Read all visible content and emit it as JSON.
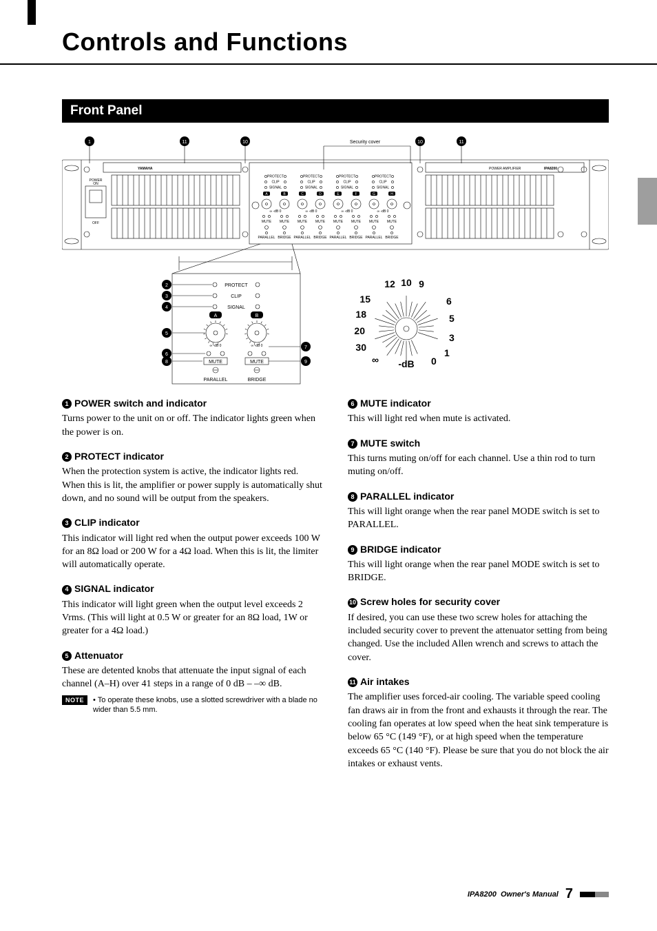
{
  "chapter_title": "Controls and Functions",
  "section_title": "Front Panel",
  "diagram": {
    "security_cover_label": "Security cover",
    "brand": "YAMAHA",
    "model_label": "POWER AMPLIFIER",
    "model_number": "IPA8200",
    "power_on": "POWER\nON",
    "off": "OFF",
    "led_rows": [
      "PROTECT",
      "CLIP",
      "SIGNAL"
    ],
    "channel_letters": [
      "A",
      "B",
      "C",
      "D",
      "E",
      "F",
      "G",
      "H"
    ],
    "db_small": "∞ -dB 0",
    "mute_row": "MUTE",
    "bottom_row_left": "PARALLEL",
    "bottom_row_right": "BRIDGE",
    "callouts_top": [
      "1",
      "11",
      "10",
      "10",
      "11"
    ],
    "detail_callouts": [
      "2",
      "3",
      "4",
      "5",
      "6",
      "8",
      "7",
      "9"
    ],
    "detail_labels": {
      "protect": "PROTECT",
      "clip": "CLIP",
      "signal": "SIGNAL",
      "a": "A",
      "b": "B",
      "mute": "MUTE",
      "parallel": "PARALLEL",
      "bridge": "BRIDGE",
      "db": "∞  -dB  0"
    },
    "dial_ticks": [
      "12",
      "10",
      "9",
      "15",
      "6",
      "18",
      "5",
      "20",
      "3",
      "30",
      "∞",
      "-dB",
      "0",
      "1"
    ]
  },
  "items_left": [
    {
      "num": "1",
      "title": "POWER switch and indicator",
      "body": "Turns power to the unit on or off. The indicator lights green when the power is on."
    },
    {
      "num": "2",
      "title": "PROTECT indicator",
      "body": "When the protection system is active, the indicator lights red. When this is lit, the amplifier or power supply is automatically shut down, and no sound will be output from the speakers."
    },
    {
      "num": "3",
      "title": "CLIP indicator",
      "body": "This indicator will light red when the output power exceeds 100 W for an 8Ω load or 200 W for a 4Ω load. When this is lit, the limiter will automatically operate."
    },
    {
      "num": "4",
      "title": "SIGNAL indicator",
      "body": "This indicator will light green when the output level exceeds 2 Vrms. (This will light at 0.5 W or greater for an 8Ω load, 1W or greater for a 4Ω load.)"
    },
    {
      "num": "5",
      "title": "Attenuator",
      "body": "These are detented knobs that attenuate the input signal of each channel (A–H) over 41 steps in a range of 0 dB – –∞ dB."
    }
  ],
  "note": {
    "badge": "NOTE",
    "bullet": "•",
    "text": "To operate these knobs, use a slotted screwdriver with a blade no wider than 5.5 mm."
  },
  "items_right": [
    {
      "num": "6",
      "title": "MUTE indicator",
      "body": "This will light red when mute is activated."
    },
    {
      "num": "7",
      "title": "MUTE switch",
      "body": "This turns muting on/off for each channel. Use a thin rod to turn muting on/off."
    },
    {
      "num": "8",
      "title": "PARALLEL indicator",
      "body": "This will light orange when the rear panel MODE switch is set to PARALLEL."
    },
    {
      "num": "9",
      "title": "BRIDGE indicator",
      "body": "This will light orange when the rear panel MODE switch is set to BRIDGE."
    },
    {
      "num": "10",
      "title": "Screw holes for security cover",
      "body": "If desired, you can use these two screw holes for attaching the included security cover to prevent the attenuator setting from being changed. Use the included Allen wrench and screws to attach the cover."
    },
    {
      "num": "11",
      "title": "Air intakes",
      "body": "The amplifier uses forced-air cooling. The variable speed cooling fan draws air in from the front and exhausts it through the rear. The cooling fan operates at low speed when the heat sink temperature is below 65 °C (149 °F), or at high speed when the temperature exceeds 65 °C (140 °F). Please be sure that you do not block the air intakes or exhaust vents."
    }
  ],
  "footer": {
    "product": "IPA8200",
    "doc": "Owner's Manual",
    "page": "7"
  }
}
